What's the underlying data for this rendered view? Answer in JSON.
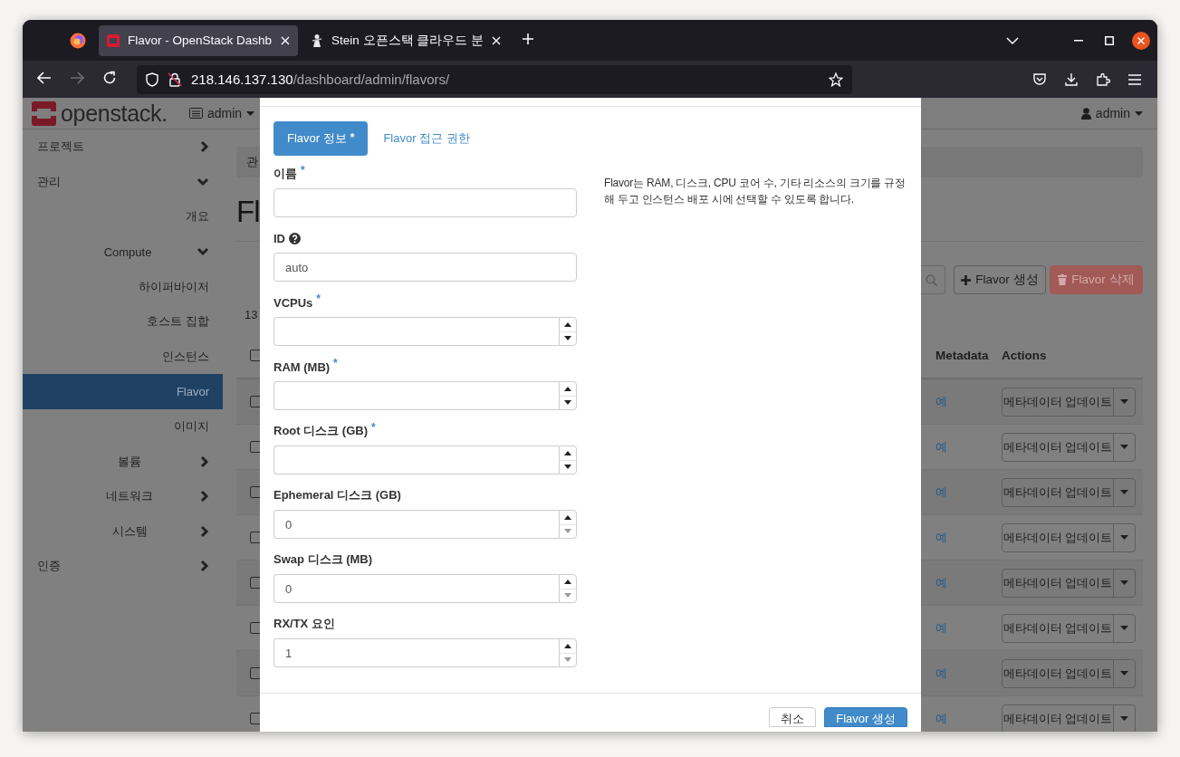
{
  "browser": {
    "tabs": [
      {
        "title": "Flavor - OpenStack Dashb",
        "selected": true
      },
      {
        "title": "Stein 오픈스택 클라우드 분",
        "selected": false
      }
    ],
    "url": "**218.146.137.130**/dashboard/admin/flavors/"
  },
  "header": {
    "logo": "openstack.",
    "project": "admin",
    "user": "admin"
  },
  "sidebar": {
    "items": [
      {
        "label": "프로젝트",
        "kind": "group",
        "expanded": false
      },
      {
        "label": "관리",
        "kind": "group",
        "expanded": true,
        "children": [
          {
            "label": "개요",
            "kind": "link",
            "selected": false
          },
          {
            "label": "Compute",
            "kind": "group",
            "expanded": true,
            "children": [
              {
                "label": "하이퍼바이저",
                "kind": "link",
                "selected": false
              },
              {
                "label": "호스트 집합",
                "kind": "link",
                "selected": false
              },
              {
                "label": "인스턴스",
                "kind": "link",
                "selected": false
              },
              {
                "label": "Flavor",
                "kind": "link",
                "selected": true
              },
              {
                "label": "이미지",
                "kind": "link",
                "selected": false
              }
            ]
          },
          {
            "label": "볼륨",
            "kind": "group",
            "expanded": false
          },
          {
            "label": "네트워크",
            "kind": "group",
            "expanded": false
          },
          {
            "label": "시스템",
            "kind": "group",
            "expanded": false
          }
        ]
      },
      {
        "label": "인증",
        "kind": "group",
        "expanded": false
      }
    ]
  },
  "content": {
    "breadcrumb": "관",
    "title": "Fl",
    "count": "13",
    "buttons": [
      {
        "label": "Flavor 생성",
        "kind": "create",
        "disabled": false
      },
      {
        "label": "Flavor 삭제",
        "kind": "delete",
        "disabled": true
      }
    ],
    "table": {
      "columns": [
        "Metadata",
        "Actions"
      ],
      "header_checked": false,
      "rows": [
        {
          "checked": false,
          "metadata": "예",
          "action": "메타데이터 업데이트"
        },
        {
          "checked": false,
          "metadata": "예",
          "action": "메타데이터 업데이트"
        },
        {
          "checked": false,
          "metadata": "예",
          "action": "메타데이터 업데이트"
        },
        {
          "checked": false,
          "metadata": "예",
          "action": "메타데이터 업데이트"
        },
        {
          "checked": false,
          "metadata": "예",
          "action": "메타데이터 업데이트"
        },
        {
          "checked": false,
          "metadata": "예",
          "action": "메타데이터 업데이트"
        },
        {
          "checked": false,
          "metadata": "예",
          "action": "메타데이터 업데이트"
        },
        {
          "checked": false,
          "metadata": "예",
          "action": "메타데이터 업데이트"
        }
      ]
    }
  },
  "modal": {
    "tabs": [
      {
        "label": "Flavor 정보",
        "mark": "*",
        "selected": true
      },
      {
        "label": "Flavor 접근 권한",
        "selected": false
      }
    ],
    "fields": [
      {
        "label": "이름",
        "mark": "*",
        "help": false,
        "kind": "text"
      },
      {
        "label": "ID",
        "help": true,
        "kind": "text",
        "value": "auto"
      },
      {
        "label": "VCPUs",
        "mark": "*",
        "help": false,
        "kind": "number",
        "down_disabled": false
      },
      {
        "label": "RAM (MB)",
        "mark": "*",
        "help": false,
        "kind": "number",
        "down_disabled": false
      },
      {
        "label": "Root 디스크 (GB)",
        "mark": "*",
        "help": false,
        "kind": "number",
        "down_disabled": false
      },
      {
        "label": "Ephemeral 디스크 (GB)",
        "help": false,
        "kind": "number",
        "value": "0",
        "down_disabled": true
      },
      {
        "label": "Swap 디스크 (MB)",
        "help": false,
        "kind": "number",
        "value": "0",
        "down_disabled": true
      },
      {
        "label": "RX/TX 요인",
        "help": false,
        "kind": "number",
        "value": "1",
        "down_disabled": true
      }
    ],
    "description": "Flavor는 RAM, 디스크, CPU 코어 수, 기타 리소스의 크기를 규정해 두고 인스턴스 배포 시에 선택할 수 있도록 합니다.",
    "buttons": [
      {
        "label": "취소",
        "kind": "default"
      },
      {
        "label": "Flavor 생성",
        "kind": "primary"
      }
    ]
  }
}
